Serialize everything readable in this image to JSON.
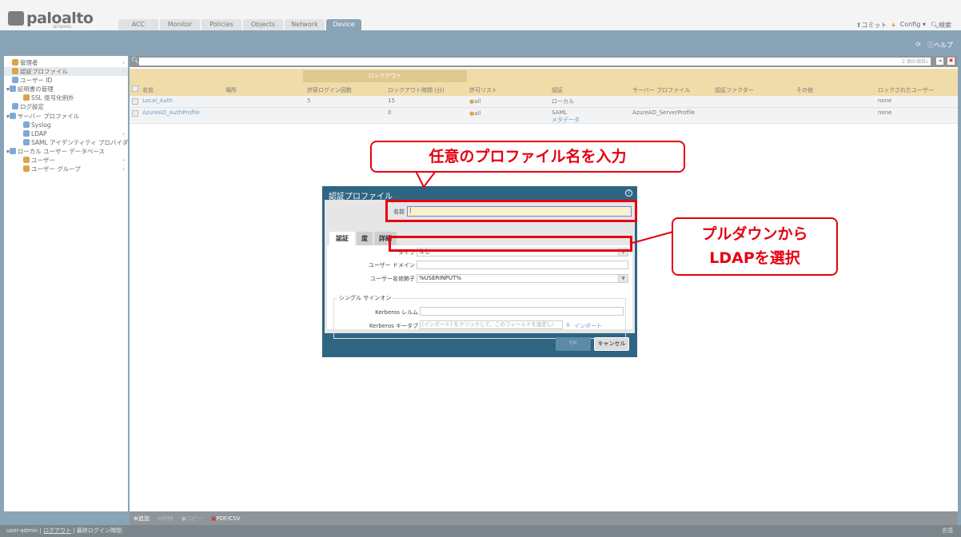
{
  "header": {
    "logo": "paloalto",
    "logo_sub": "NETWORKS",
    "tabs": [
      "ACC",
      "Monitor",
      "Policies",
      "Objects",
      "Network",
      "Device"
    ],
    "links": {
      "commit": "コミット",
      "config": "Config",
      "search": "検索"
    },
    "help": "ヘルプ"
  },
  "sidebar": {
    "items": [
      {
        "label": "管理者"
      },
      {
        "label": "認証プロファイル"
      },
      {
        "label": "ユーザー ID"
      },
      {
        "label": "証明書の管理"
      },
      {
        "label": "SSL 復号化例外"
      },
      {
        "label": "ログ設定"
      },
      {
        "label": "サーバー プロファイル"
      },
      {
        "label": "Syslog"
      },
      {
        "label": "LDAP"
      },
      {
        "label": "SAML アイデンティティ プロバイダ"
      },
      {
        "label": "ローカル ユーザー データベース"
      },
      {
        "label": "ユーザー"
      },
      {
        "label": "ユーザー グループ"
      }
    ]
  },
  "table": {
    "item_count": "2 個の項目s",
    "group": "ロックアウト",
    "columns": [
      "名前",
      "場所",
      "許容ログイン回数",
      "ロックアウト時間 (分)",
      "許可リスト",
      "認証",
      "サーバー プロファイル",
      "認証ファクター",
      "その他",
      "ロックされたユーザー"
    ],
    "rows": [
      {
        "name": "Local_Auth",
        "location": "",
        "attempts": "5",
        "lockout": "15",
        "allow": "all",
        "auth": "ローカル",
        "auth2": "",
        "server": "",
        "factor": "",
        "other": "",
        "locked": "none"
      },
      {
        "name": "AzureAD_AuthProfile",
        "location": "",
        "attempts": "",
        "lockout": "0",
        "allow": "all",
        "auth": "SAML",
        "auth2": "メタデータ",
        "server": "AzureAD_ServerProfile",
        "factor": "",
        "other": "",
        "locked": "none"
      }
    ]
  },
  "toolbar": {
    "add": "追加",
    "delete": "削除",
    "copy": "コピー",
    "pdf": "PDF/CSV"
  },
  "status": {
    "user": "user-admin",
    "logout": "ログアウト",
    "last_login": "最終ログイン時間:",
    "lang": "言語"
  },
  "dialog": {
    "title": "認証プロファイル",
    "name_label": "名前",
    "name_value": "",
    "tabs": [
      "認証",
      "度",
      "詳細"
    ],
    "type_label": "タイプ",
    "type_value": "なし",
    "domain_label": "ユーザー ドメイン",
    "domain_value": "",
    "modifier_label": "ユーザー名修飾子",
    "modifier_value": "%USERINPUT%",
    "sso_legend": "シングル サインオン",
    "realm_label": "Kerberos レルム",
    "realm_value": "",
    "keytab_label": "Kerberos キータブ",
    "keytab_placeholder": "[インポート] をクリックして、このフィールドを設定し!",
    "keytab_clear": "X",
    "keytab_import": "インポート",
    "ok": "OK",
    "cancel": "キャンセル"
  },
  "annotations": {
    "callout1": "任意のプロファイル名を入力",
    "callout2_line1": "プルダウンから",
    "callout2_line2": "LDAPを選択"
  },
  "colors": {
    "accent": "#8aa4b7",
    "dialog": "#2e6583",
    "annotation": "#e60012",
    "header_row": "#f0dca9"
  }
}
